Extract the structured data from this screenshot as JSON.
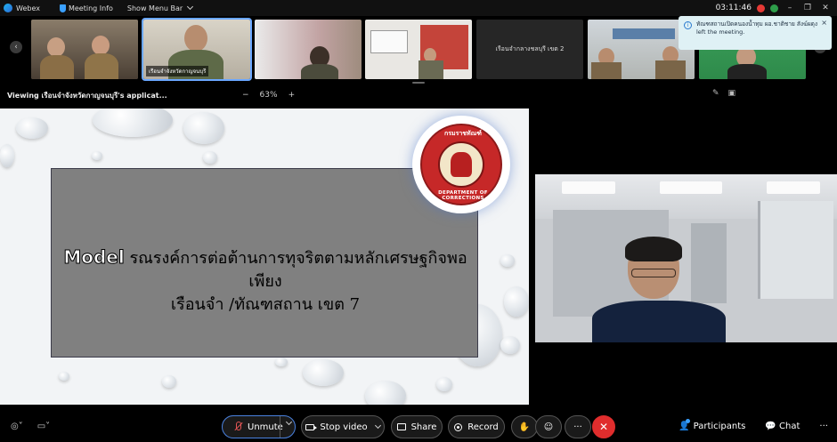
{
  "titlebar": {
    "app_name": "Webex",
    "meeting_info": "Meeting Info",
    "show_menu_bar": "Show Menu Bar",
    "time": "03:11:46"
  },
  "participants_strip": [
    {
      "label": ""
    },
    {
      "label": "เรือนจำจังหวัดกาญจนบุรี"
    },
    {
      "label": ""
    },
    {
      "label": ""
    },
    {
      "label": "เรือนจำกลางชลบุรี เขต 2"
    },
    {
      "label": ""
    },
    {
      "label": ""
    }
  ],
  "toast": {
    "text": "ทัณฑสถานเปิดคนองน้ำทุม ผอ.ชาติชาย สังฆ์ผดุง left the meeting."
  },
  "viewbar": {
    "title": "Viewing เรือนจำจังหวัดกาญจนบุรี's applicat...",
    "zoom_minus": "−",
    "zoom_level": "63%",
    "zoom_plus": "+"
  },
  "slide": {
    "model_word": "Model",
    "line1": " รณรงค์การต่อต้านการทุจริตตามหลักเศรษฐกิจพอเพียง",
    "line2": "เรือนจำ /ทัณฑสถาน  เขต 7",
    "seal_top": "กรมราชทัณฑ์",
    "seal_bottom": "DEPARTMENT OF CORRECTIONS"
  },
  "controls": {
    "unmute": "Unmute",
    "stop_video": "Stop video",
    "share": "Share",
    "record": "Record",
    "participants": "Participants",
    "chat": "Chat",
    "end_icon": "✕",
    "more": "···"
  },
  "colors": {
    "accent": "#4a82e0",
    "end_call": "#e02d2d",
    "mute_red": "#e25555"
  }
}
